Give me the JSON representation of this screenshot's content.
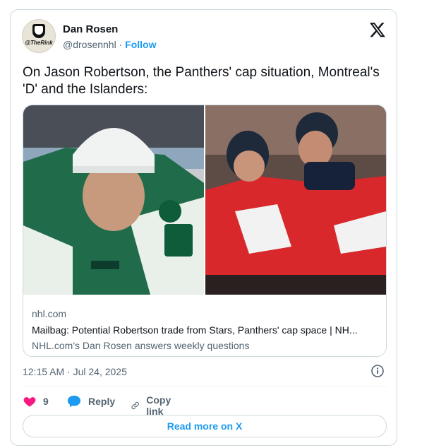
{
  "author": {
    "name": "Dan Rosen",
    "handle": "@drosennhl",
    "separator": "·",
    "follow_label": "Follow",
    "avatar_text": "@TheRink"
  },
  "tweet": {
    "text": "On Jason Robertson, the Panthers' cap situation, Montreal's 'D' and the Islanders:"
  },
  "link_card": {
    "domain": "nhl.com",
    "headline": "Mailbag: Potential Robertson trade from Stars, Panthers' cap space | NH...",
    "description": "NHL.com's Dan Rosen answers weekly questions"
  },
  "timestamp": "12:15 AM · Jul 24, 2025",
  "actions": {
    "like_count": "9",
    "reply_label": "Reply",
    "copy_link_label": "Copy link"
  },
  "read_more_label": "Read more on X",
  "colors": {
    "accent": "#1d9bf0",
    "like": "#f91880",
    "secondary_text": "#536471",
    "border": "#cfd9de"
  }
}
